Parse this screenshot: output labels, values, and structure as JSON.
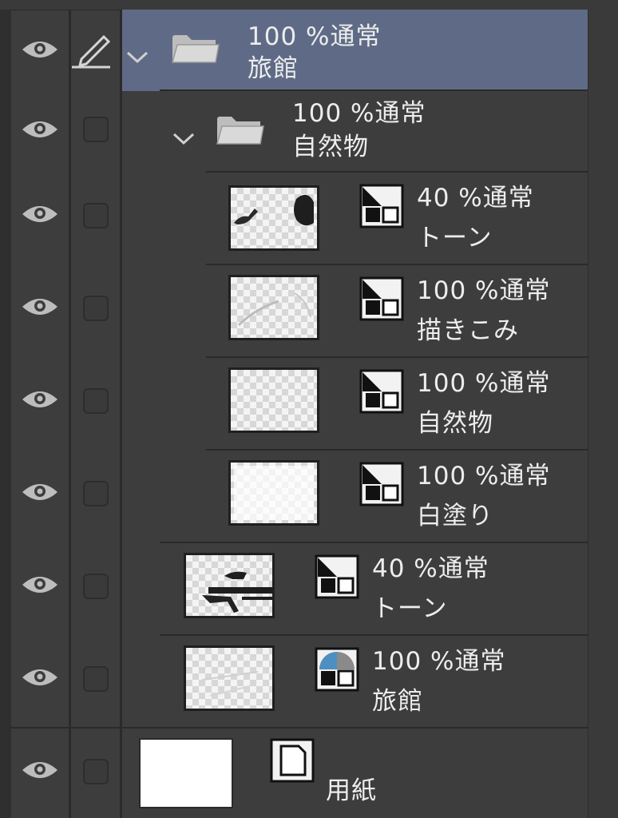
{
  "layers": [
    {
      "opacity": "100 %通常",
      "name": "旅館",
      "kind": "folder",
      "selected": true,
      "editing": true
    },
    {
      "opacity": "100 %通常",
      "name": "自然物",
      "kind": "folder"
    },
    {
      "opacity": "40 %通常",
      "name": "トーン",
      "kind": "raster"
    },
    {
      "opacity": "100 %通常",
      "name": "描きこみ",
      "kind": "raster"
    },
    {
      "opacity": "100 %通常",
      "name": "自然物",
      "kind": "raster"
    },
    {
      "opacity": "100 %通常",
      "name": "白塗り",
      "kind": "raster"
    },
    {
      "opacity": "40 %通常",
      "name": "トーン",
      "kind": "raster"
    },
    {
      "opacity": "100 %通常",
      "name": "旅館",
      "kind": "vector"
    },
    {
      "opacity": "",
      "name": "用紙",
      "kind": "paper"
    }
  ],
  "icons": {
    "visibility": "eye-icon",
    "edit": "pencil-icon",
    "expand": "chevron-down-icon",
    "folder": "folder-icon",
    "raster": "raster-layer-icon",
    "vector": "vector-layer-icon",
    "paper": "paper-layer-icon"
  },
  "colors": {
    "selected_row": "#5f6b86",
    "panel_bg": "#3d3d3d",
    "text": "#ededed"
  }
}
